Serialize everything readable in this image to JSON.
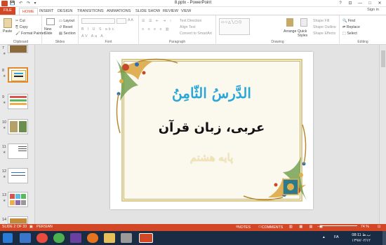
{
  "window": {
    "title": "8.pptx - PowerPoint",
    "buttons": [
      "?",
      "⊡",
      "—",
      "□",
      "✕"
    ]
  },
  "tabs": [
    "FILE",
    "HOME",
    "INSERT",
    "DESIGN",
    "TRANSITIONS",
    "ANIMATIONS",
    "SLIDE SHOW",
    "REVIEW",
    "VIEW"
  ],
  "signin": "Sign in",
  "ribbon": {
    "clipboard": {
      "label": "Clipboard",
      "paste": "Paste",
      "cut": "Cut",
      "copy": "Copy",
      "format_painter": "Format Painter"
    },
    "slides": {
      "label": "Slides",
      "new_slide": "New Slide",
      "layout": "Layout",
      "reset": "Reset",
      "section": "Section"
    },
    "font": {
      "label": "Font"
    },
    "paragraph": {
      "label": "Paragraph",
      "text_direction": "Text Direction",
      "align_text": "Align Text",
      "convert": "Convert to SmartArt"
    },
    "drawing": {
      "label": "Drawing",
      "arrange": "Arrange",
      "quick_styles": "Quick Styles",
      "shape_fill": "Shape Fill",
      "shape_outline": "Shape Outline",
      "shape_effects": "Shape Effects"
    },
    "editing": {
      "label": "Editing",
      "find": "Find",
      "replace": "Replace",
      "select": "Select"
    }
  },
  "thumbnails": [
    {
      "num": "7",
      "star": "★"
    },
    {
      "num": "8",
      "star": "★"
    },
    {
      "num": "9",
      "star": "★"
    },
    {
      "num": "10",
      "star": "★"
    },
    {
      "num": "11",
      "star": "★"
    },
    {
      "num": "12",
      "star": "★"
    },
    {
      "num": "13",
      "star": "★"
    },
    {
      "num": "14",
      "star": "★"
    }
  ],
  "slide": {
    "line1": "الدَّرسُ الثّامِنُ",
    "line2": "عربی، زبان قرآن",
    "line3": "پایه هشتم"
  },
  "statusbar": {
    "slide_info": "SLIDE 2 OF 33",
    "language": "PERSIAN",
    "notes": "NOTES",
    "comments": "COMMENTS",
    "zoom": "74 %"
  },
  "taskbar": {
    "time": "08:11 ب.ظ",
    "date": "۱۳۹۷/۰۲/۱۲",
    "lang": "FA"
  },
  "colors": {
    "accent": "#d24726",
    "title_blue": "#2aa6d8"
  }
}
